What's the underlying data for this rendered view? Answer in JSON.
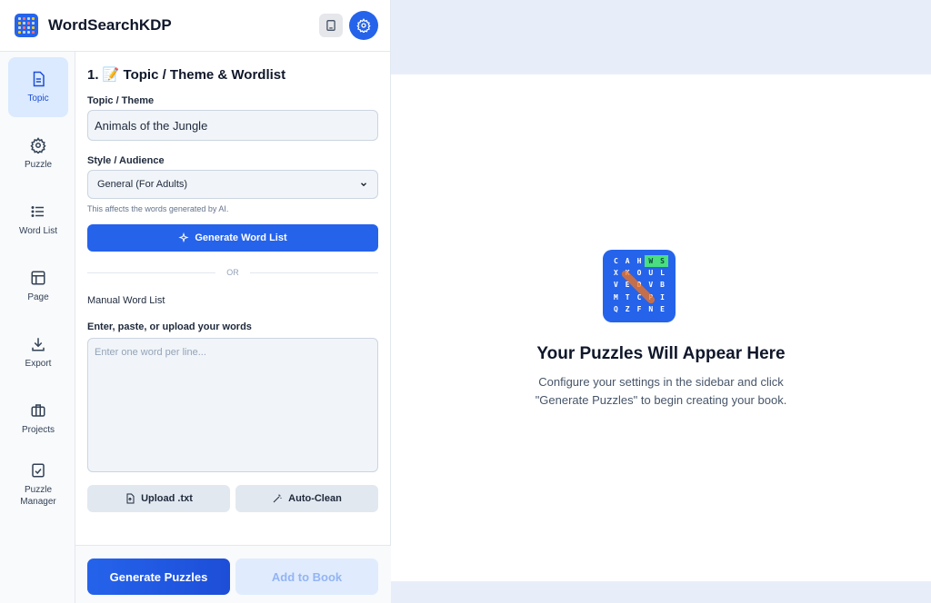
{
  "app": {
    "title": "WordSearchKDP"
  },
  "nav": {
    "items": [
      {
        "label": "Topic",
        "icon": "document-icon",
        "active": true
      },
      {
        "label": "Puzzle",
        "icon": "gear-icon"
      },
      {
        "label": "Word List",
        "icon": "list-icon"
      },
      {
        "label": "Page",
        "icon": "layout-icon"
      },
      {
        "label": "Export",
        "icon": "download-icon"
      },
      {
        "label": "Projects",
        "icon": "briefcase-icon"
      },
      {
        "label": "Puzzle Manager",
        "icon": "clipboard-check-icon"
      }
    ]
  },
  "panel": {
    "section_title": "1. 📝 Topic / Theme & Wordlist",
    "topic_label": "Topic / Theme",
    "topic_value": "Animals of the Jungle",
    "style_label": "Style / Audience",
    "style_value": "General (For Adults)",
    "style_hint": "This affects the words generated by AI.",
    "generate_wordlist_label": "Generate Word List",
    "or_text": "OR",
    "manual_label": "Manual Word List",
    "enter_label": "Enter, paste, or upload your words",
    "textarea_placeholder": "Enter one word per line...",
    "upload_label": "Upload .txt",
    "autoclean_label": "Auto-Clean"
  },
  "footer": {
    "generate_label": "Generate Puzzles",
    "add_label": "Add to Book"
  },
  "main": {
    "title": "Your Puzzles Will Appear Here",
    "subtitle_line1": "Configure your settings in the sidebar and click",
    "subtitle_line2": "\"Generate Puzzles\" to begin creating your book.",
    "grid_letters": [
      "C",
      "A",
      "H",
      "W",
      "S",
      "X",
      "K",
      "O",
      "U",
      "L",
      "V",
      "E",
      "D",
      "V",
      "B",
      "M",
      "T",
      "C",
      "P",
      "I",
      "Q",
      "Z",
      "F",
      "N",
      "E"
    ]
  },
  "colors": {
    "primary": "#2563eb",
    "active_bg": "#dbeafe",
    "highlight": "#4ade80",
    "accent": "#f97316"
  }
}
